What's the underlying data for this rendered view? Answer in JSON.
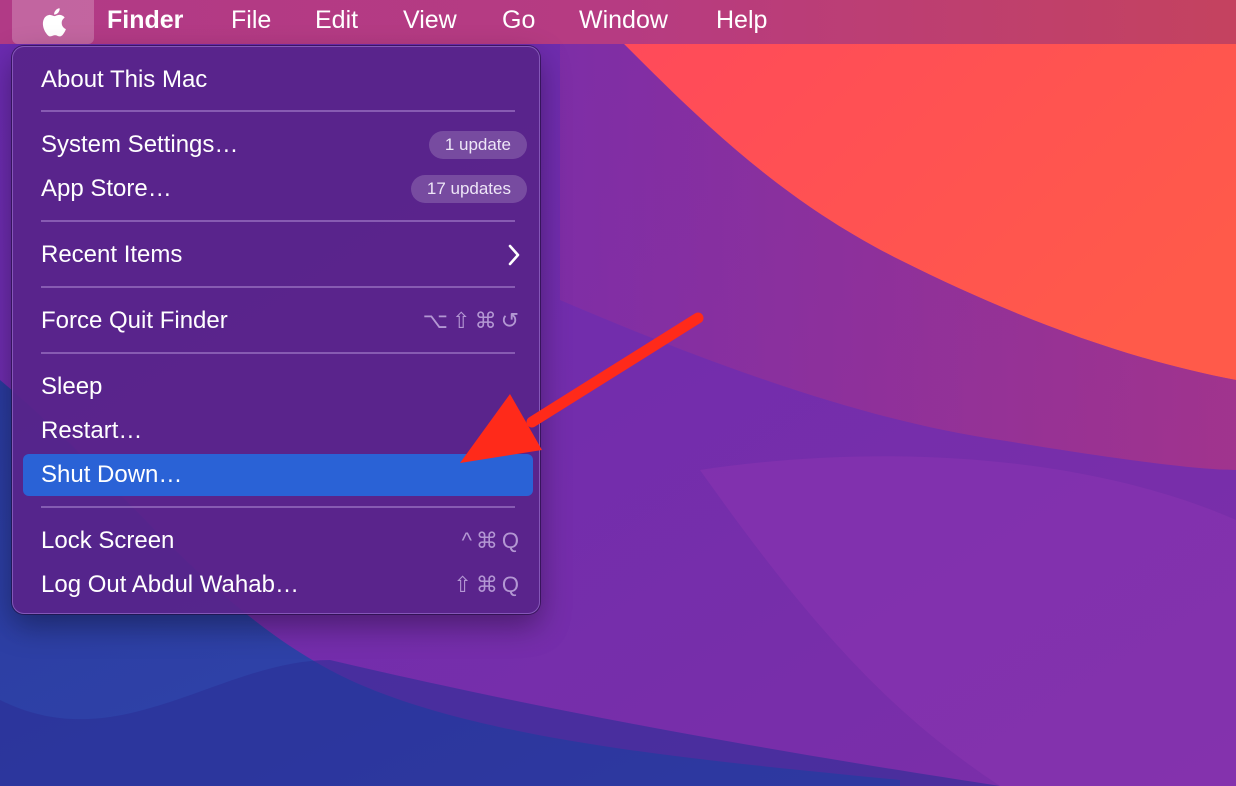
{
  "menubar": {
    "apple_icon": "apple-logo-icon",
    "items": [
      {
        "label": "Finder"
      },
      {
        "label": "File"
      },
      {
        "label": "Edit"
      },
      {
        "label": "View"
      },
      {
        "label": "Go"
      },
      {
        "label": "Window"
      },
      {
        "label": "Help"
      }
    ]
  },
  "apple_menu": {
    "about": {
      "label": "About This Mac"
    },
    "system_settings": {
      "label": "System Settings…",
      "badge": "1 update"
    },
    "app_store": {
      "label": "App Store…",
      "badge": "17 updates"
    },
    "recent_items": {
      "label": "Recent Items",
      "icon": "chevron-right-icon"
    },
    "force_quit": {
      "label": "Force Quit Finder",
      "shortcut": "⌥⇧⌘↺"
    },
    "sleep": {
      "label": "Sleep"
    },
    "restart": {
      "label": "Restart…"
    },
    "shut_down": {
      "label": "Shut Down…",
      "highlighted": true
    },
    "lock_screen": {
      "label": "Lock Screen",
      "shortcut": "^⌘Q"
    },
    "log_out": {
      "label": "Log Out Abdul Wahab…",
      "shortcut": "⇧⌘Q"
    }
  },
  "colors": {
    "highlight": "#2a62d6",
    "menu_bg": "#58248a",
    "annotation_arrow": "#ff2a1a",
    "wallpaper_purple": "#7a2fa6",
    "wallpaper_coral": "#ff5050",
    "wallpaper_blue": "#2d3fa0"
  },
  "annotation": {
    "icon": "red-arrow-icon"
  }
}
